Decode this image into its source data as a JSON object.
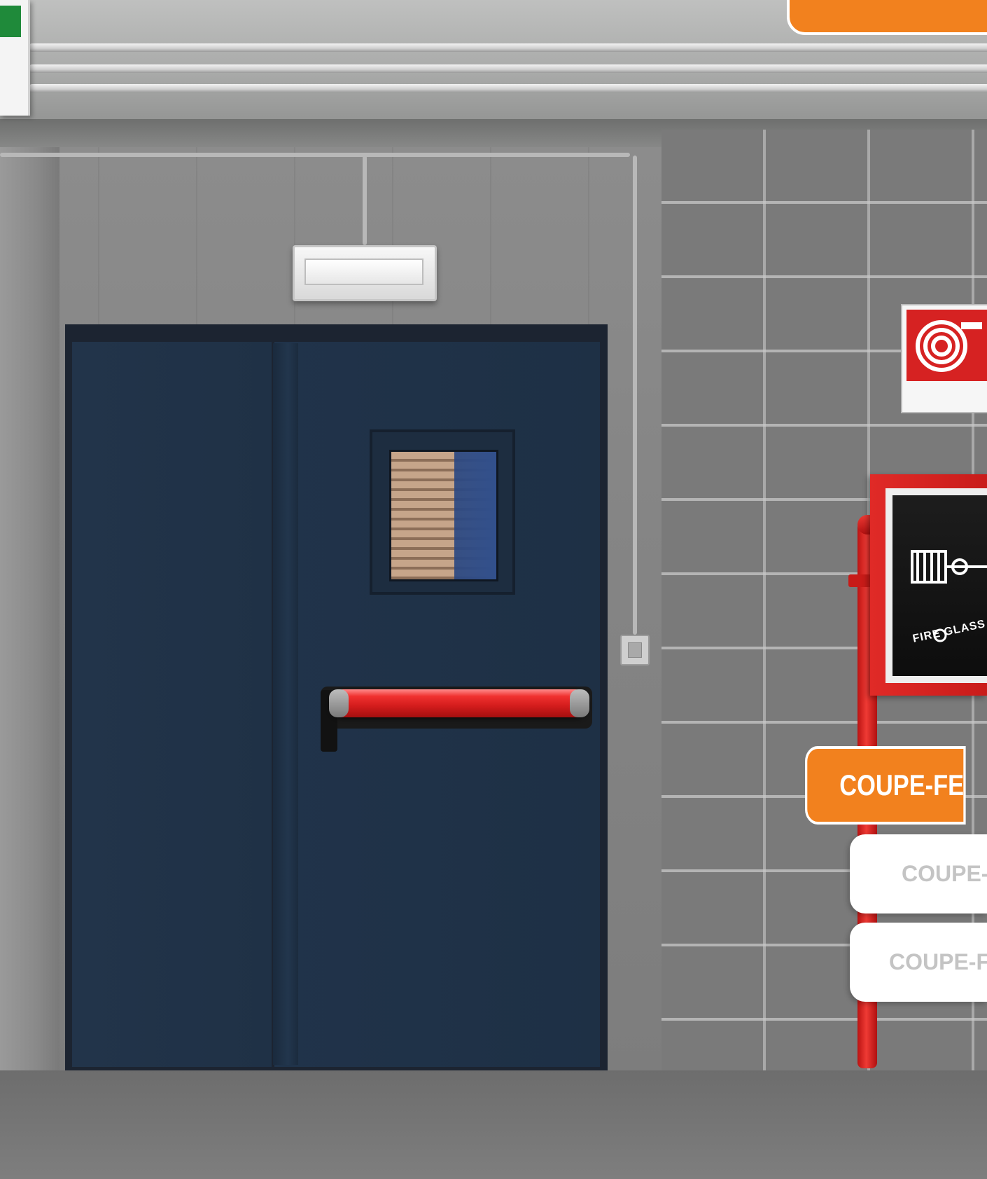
{
  "navigation": {
    "tabs": [
      {
        "label": "COUPE-FE",
        "active": true
      },
      {
        "label": "COUPE-F",
        "active": false
      },
      {
        "label": "COUPE-FE",
        "active": false
      }
    ]
  },
  "cabinet": {
    "label": "FIRE GLASS"
  },
  "colors": {
    "accent": "#f2811e",
    "door": "#1f3146",
    "fire_red": "#d62222"
  },
  "icons": {
    "hose_sign": "fire-hose-spiral-icon",
    "exit_sign": "emergency-exit-sign-icon"
  }
}
